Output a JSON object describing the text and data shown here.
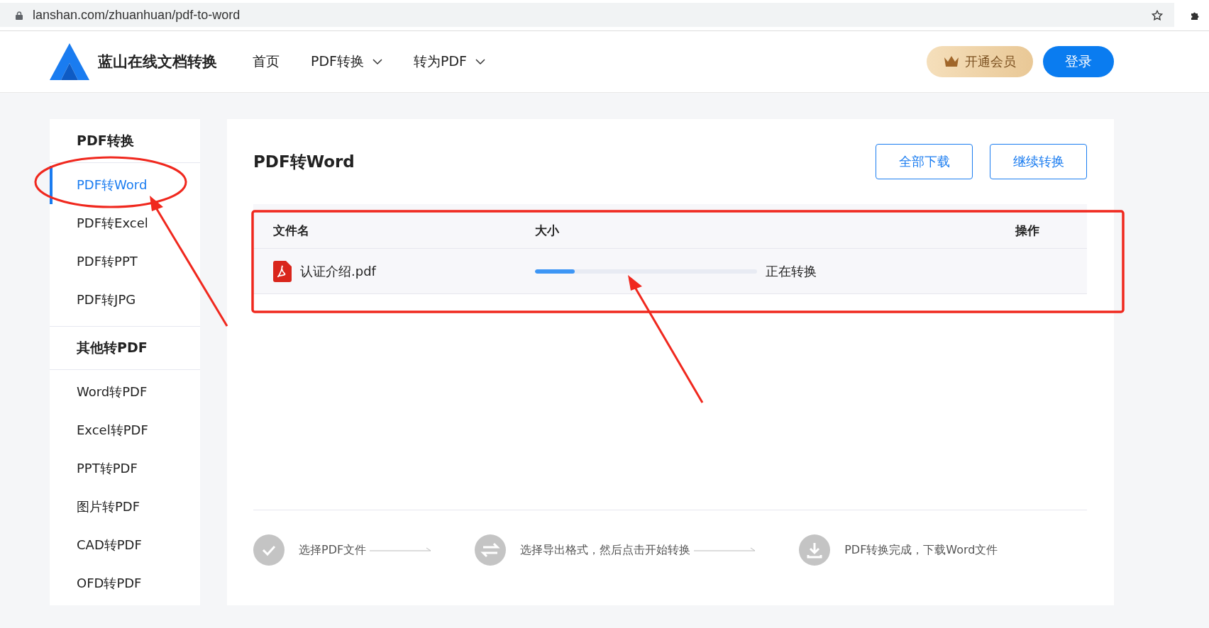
{
  "browser": {
    "url": "lanshan.com/zhuanhuan/pdf-to-word"
  },
  "header": {
    "brand": "蓝山在线文档转换",
    "nav": [
      {
        "label": "首页",
        "dropdown": false
      },
      {
        "label": "PDF转换",
        "dropdown": true
      },
      {
        "label": "转为PDF",
        "dropdown": true
      }
    ],
    "vip_button": "开通会员",
    "login_button": "登录"
  },
  "sidebar": [
    {
      "title": "PDF转换",
      "items": [
        {
          "label": "PDF转Word",
          "selected": true
        },
        {
          "label": "PDF转Excel",
          "selected": false
        },
        {
          "label": "PDF转PPT",
          "selected": false
        },
        {
          "label": "PDF转JPG",
          "selected": false
        }
      ]
    },
    {
      "title": "其他转PDF",
      "items": [
        {
          "label": "Word转PDF",
          "selected": false
        },
        {
          "label": "Excel转PDF",
          "selected": false
        },
        {
          "label": "PPT转PDF",
          "selected": false
        },
        {
          "label": "图片转PDF",
          "selected": false
        },
        {
          "label": "CAD转PDF",
          "selected": false
        },
        {
          "label": "OFD转PDF",
          "selected": false
        }
      ]
    }
  ],
  "main": {
    "title": "PDF转Word",
    "buttons": [
      "全部下载",
      "继续转换"
    ],
    "table": {
      "columns": [
        "文件名",
        "大小",
        "操作"
      ],
      "rows": [
        {
          "file": "认证介绍.pdf",
          "level": 0.18,
          "status": "正在转换"
        }
      ]
    },
    "steps": [
      {
        "kind": "check",
        "label": "选择PDF文件"
      },
      {
        "kind": "swap",
        "label": "选择导出格式，然后点击开始转换"
      },
      {
        "kind": "download",
        "label": "PDF转换完成，下载Word文件"
      }
    ]
  }
}
